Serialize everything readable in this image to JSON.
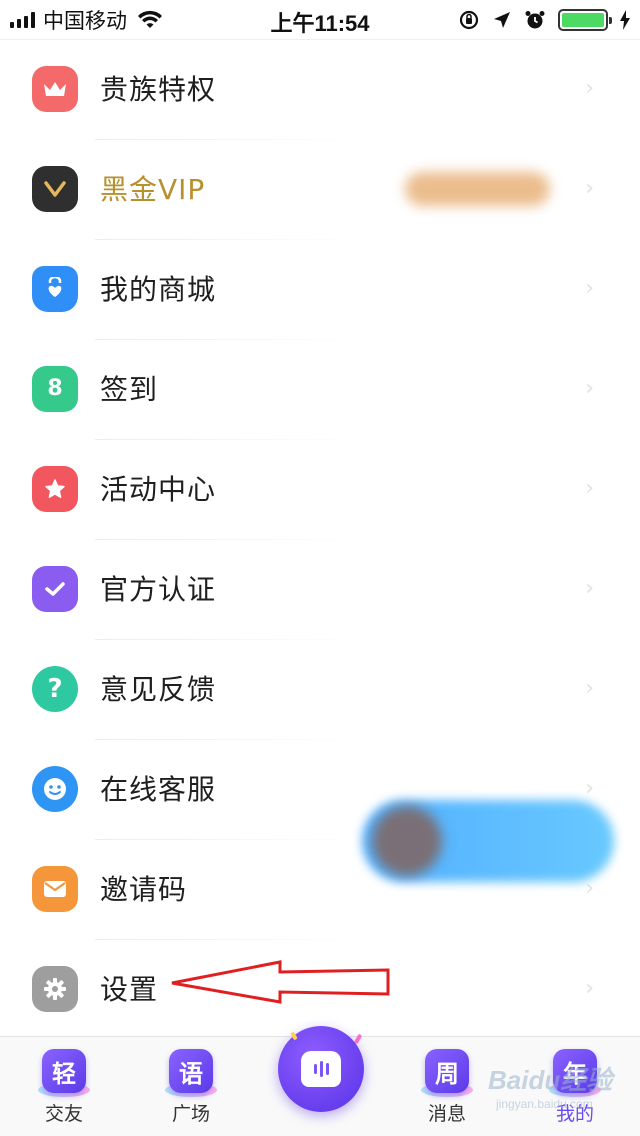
{
  "status_bar": {
    "carrier": "中国移动",
    "time": "上午11:54",
    "battery_level": 1.0
  },
  "menu": {
    "items": [
      {
        "label": "贵族特权",
        "icon": "crown-icon",
        "color": "#f46a6a"
      },
      {
        "label": "黑金VIP",
        "icon": "vip-v-icon",
        "color": "#2f2f2f",
        "label_color": "#b8902e"
      },
      {
        "label": "我的商城",
        "icon": "shopping-bag-icon",
        "color": "#2f8ff6"
      },
      {
        "label": "签到",
        "icon": "calendar-checkin-icon",
        "color": "#35c98c",
        "glyph": "8"
      },
      {
        "label": "活动中心",
        "icon": "star-icon",
        "color": "#f2575f"
      },
      {
        "label": "官方认证",
        "icon": "check-badge-icon",
        "color": "#8b5cf0"
      },
      {
        "label": "意见反馈",
        "icon": "question-icon",
        "color": "#2ec9a0",
        "glyph": "?"
      },
      {
        "label": "在线客服",
        "icon": "smiley-icon",
        "color": "#2e95f4"
      },
      {
        "label": "邀请码",
        "icon": "envelope-icon",
        "color": "#f5963b"
      },
      {
        "label": "设置",
        "icon": "gear-icon",
        "color": "#9e9e9e"
      }
    ]
  },
  "tabs": [
    {
      "label": "交友",
      "glyph": "轻"
    },
    {
      "label": "广场",
      "glyph": "语"
    },
    {
      "label": "消息",
      "glyph": "周"
    },
    {
      "label": "我的",
      "glyph": "年"
    }
  ],
  "watermark": {
    "main": "Baidu经验",
    "sub": "jingyan.baidu.com"
  }
}
